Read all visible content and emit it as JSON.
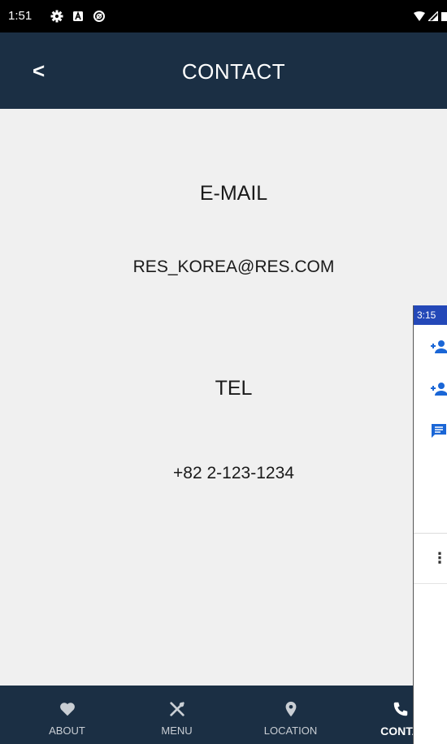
{
  "status_bar": {
    "time": "1:51",
    "icons": [
      "settings-gear-icon",
      "notification-a-icon",
      "data-saver-icon",
      "wifi-icon",
      "signal-icon",
      "battery-icon"
    ]
  },
  "app_bar": {
    "back_label": "<",
    "title": "CONTACT"
  },
  "contact": {
    "email_heading": "E-MAIL",
    "email_value": "RES_KOREA@RES.COM",
    "tel_heading": "TEL",
    "tel_value": "+82 2-123-1234"
  },
  "bottom_nav": {
    "items": [
      {
        "label": "ABOUT",
        "icon": "heart-icon"
      },
      {
        "label": "MENU",
        "icon": "utensils-icon"
      },
      {
        "label": "LOCATION",
        "icon": "map-pin-icon"
      },
      {
        "label": "CONTA",
        "icon": "phone-icon",
        "active": true
      }
    ]
  },
  "overlay_app": {
    "status_time": "3:15",
    "icons": [
      "add-contact-icon",
      "add-contact-icon",
      "message-icon",
      "more-vert-icon"
    ]
  },
  "colors": {
    "app_bar": "#1b2f44",
    "background": "#f0f0f0",
    "overlay_status": "#2448b8"
  }
}
